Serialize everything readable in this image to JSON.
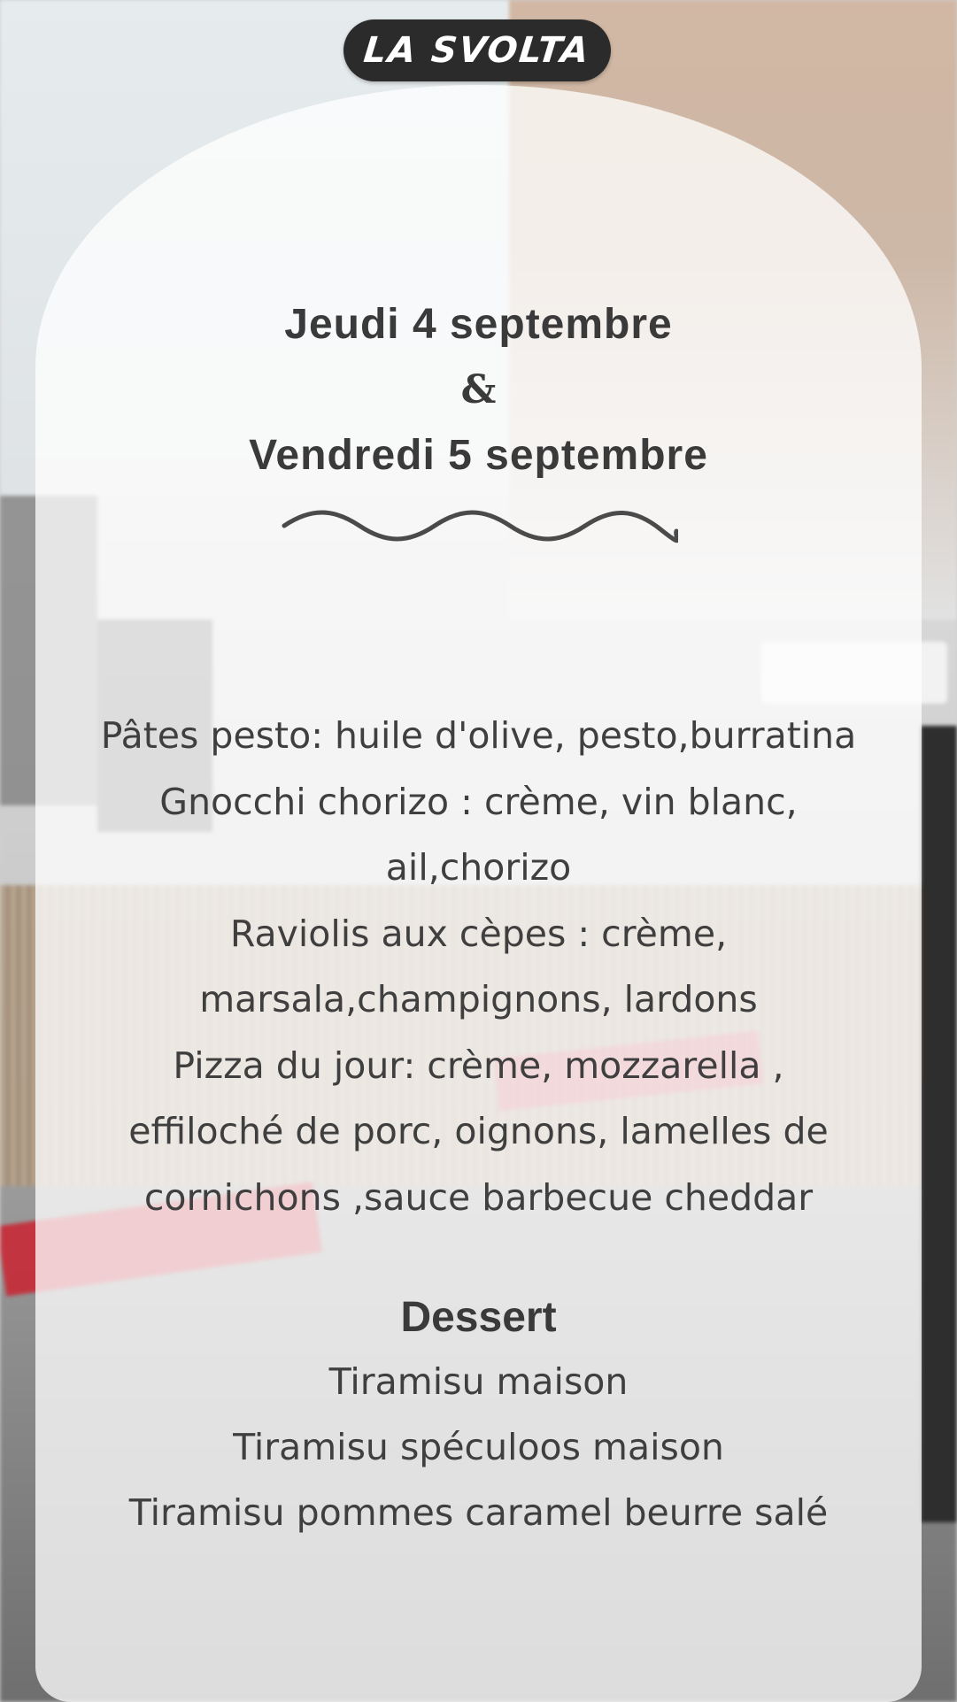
{
  "brand": {
    "logo_text": "LA SVOLTA"
  },
  "dates": {
    "line1": "Jeudi 4 septembre",
    "ampersand": "&",
    "line2": "Vendredi 5 septembre"
  },
  "menu": {
    "lines": [
      "Pâtes pesto:  huile d'olive, pesto,burratina",
      "Gnocchi chorizo : crème, vin blanc,",
      "ail,chorizo",
      "Raviolis aux cèpes : crème,",
      "marsala,champignons, lardons",
      "Pizza du jour: crème, mozzarella ,",
      "effiloché de porc, oignons, lamelles de",
      "cornichons ,sauce barbecue  cheddar"
    ]
  },
  "dessert": {
    "title": "Dessert",
    "items": [
      "Tiramisu maison",
      "Tiramisu spéculoos maison",
      "Tiramisu pommes caramel beurre salé"
    ]
  },
  "icons": {
    "divider": "wavy-line-icon"
  },
  "colors": {
    "text": "#3d3d3d",
    "pill": "#2b2b2b",
    "card": "rgba(255,255,255,0.76)"
  }
}
